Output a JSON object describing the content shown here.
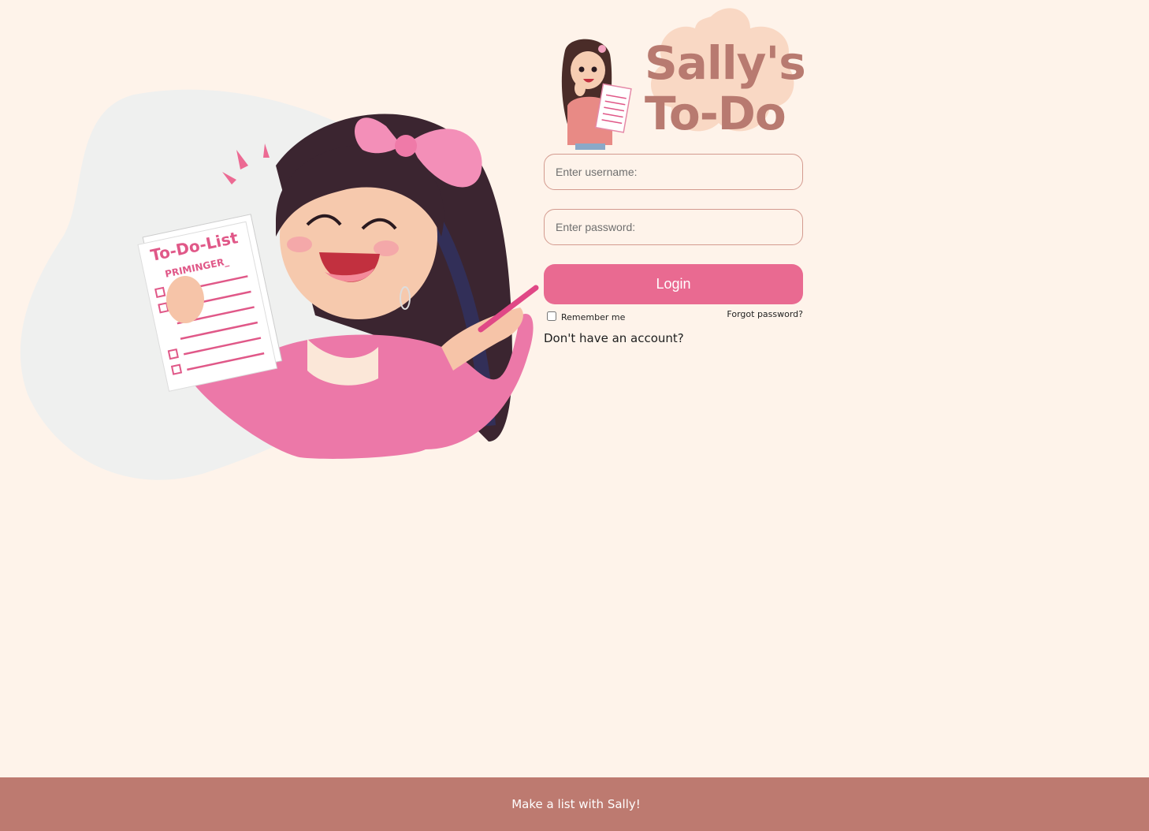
{
  "logo": {
    "line1": "Sally's",
    "line2": "To-Do"
  },
  "hero": {
    "paper_title": "To-Do-List",
    "paper_subtitle": "PRIMINGER_"
  },
  "form": {
    "username_placeholder": "Enter username:",
    "password_placeholder": "Enter password:",
    "login_label": "Login",
    "remember_label": "Remember me",
    "forgot_label": "Forgot password?",
    "signup_label": "Don't have an account?"
  },
  "footer": {
    "text": "Make a list with Sally!"
  },
  "colors": {
    "background": "#fef3ea",
    "accent_pink": "#e96a91",
    "brand_brown": "#bd7a70"
  }
}
